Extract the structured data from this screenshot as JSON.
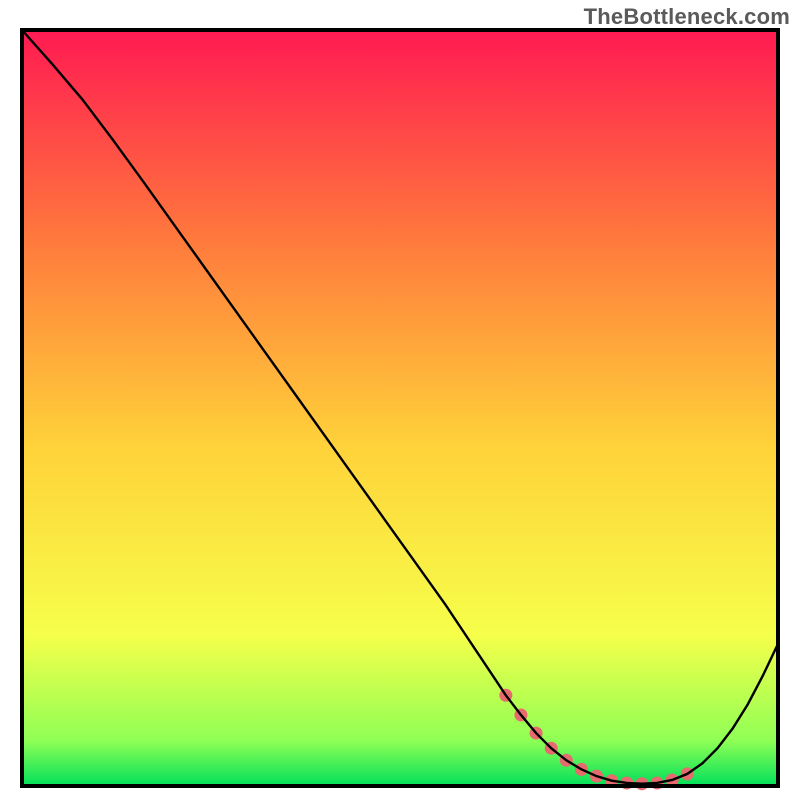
{
  "watermark": "TheBottleneck.com",
  "chart_data": {
    "type": "line",
    "title": "",
    "xlabel": "",
    "ylabel": "",
    "xlim": [
      0,
      100
    ],
    "ylim": [
      0,
      100
    ],
    "grid": false,
    "legend": false,
    "gradient_colors": {
      "top": "#ff1a52",
      "upper_mid": "#ff7a3c",
      "mid": "#ffd23a",
      "lower_mid": "#f6ff4a",
      "near_bottom": "#8fff55",
      "bottom": "#00e05a"
    },
    "series": [
      {
        "name": "bottleneck_curve",
        "type": "line",
        "color": "#000000",
        "x": [
          0,
          4,
          8,
          12,
          16,
          20,
          24,
          28,
          32,
          36,
          40,
          44,
          48,
          52,
          56,
          60,
          62,
          64,
          66,
          68,
          70,
          72,
          74,
          76,
          78,
          80,
          82,
          84,
          86,
          88,
          90,
          92,
          94,
          96,
          98,
          100
        ],
        "y": [
          100,
          95.5,
          90.8,
          85.5,
          80.0,
          74.4,
          68.8,
          63.2,
          57.6,
          52.0,
          46.4,
          40.8,
          35.2,
          29.6,
          24.0,
          18.0,
          15.0,
          12.0,
          9.4,
          7.0,
          5.0,
          3.4,
          2.2,
          1.3,
          0.7,
          0.4,
          0.3,
          0.4,
          0.8,
          1.6,
          3.0,
          5.0,
          7.6,
          10.8,
          14.6,
          18.8
        ]
      },
      {
        "name": "optimal_zone_dots",
        "type": "scatter",
        "color": "#e76a6f",
        "x": [
          64,
          66,
          68,
          70,
          72,
          74,
          76,
          78,
          80,
          82,
          84,
          86,
          88
        ],
        "y": [
          12.0,
          9.4,
          7.0,
          5.0,
          3.4,
          2.2,
          1.3,
          0.7,
          0.4,
          0.3,
          0.4,
          0.8,
          1.6
        ]
      }
    ]
  }
}
